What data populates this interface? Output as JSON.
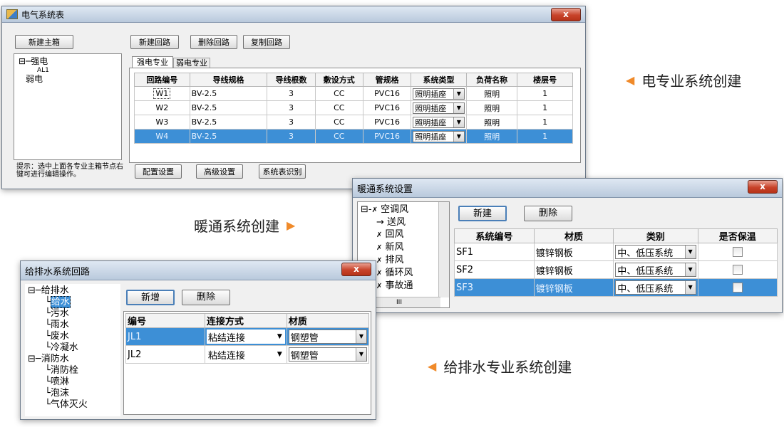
{
  "win1": {
    "title": "电气系统表",
    "close": "x",
    "new_main_box": "新建主箱",
    "new_circuit": "新建回路",
    "delete_circuit": "删除回路",
    "copy_circuit": "复制回路",
    "tree": [
      "强电",
      "AL1",
      "弱电"
    ],
    "hint": "提示：选中上面各专业主箱节点右键可进行编辑操作。",
    "tabs": [
      "强电专业",
      "弱电专业"
    ],
    "columns": [
      "回路编号",
      "导线规格",
      "导线根数",
      "敷设方式",
      "管规格",
      "系统类型",
      "负荷名称",
      "楼层号"
    ],
    "rows": [
      [
        "W1",
        "BV-2.5",
        "3",
        "CC",
        "PVC16",
        "照明插座",
        "照明",
        "1"
      ],
      [
        "W2",
        "BV-2.5",
        "3",
        "CC",
        "PVC16",
        "照明插座",
        "照明",
        "1"
      ],
      [
        "W3",
        "BV-2.5",
        "3",
        "CC",
        "PVC16",
        "照明插座",
        "照明",
        "1"
      ],
      [
        "W4",
        "BV-2.5",
        "3",
        "CC",
        "PVC16",
        "照明插座",
        "照明",
        "1"
      ]
    ],
    "config_settings": "配置设置",
    "advanced_settings": "高级设置",
    "system_table_recognition": "系统表识别"
  },
  "win2": {
    "title": "暖通系统设置",
    "close": "x",
    "tree": [
      "空调风",
      "送风",
      "回风",
      "新风",
      "排风",
      "循环风",
      "事故通"
    ],
    "scroll_label": "III",
    "new": "新建",
    "delete": "删除",
    "columns": [
      "系统编号",
      "材质",
      "类别",
      "是否保温"
    ],
    "rows": [
      [
        "SF1",
        "镀锌钢板",
        "中、低压系统"
      ],
      [
        "SF2",
        "镀锌钢板",
        "中、低压系统"
      ],
      [
        "SF3",
        "镀锌钢板",
        "中、低压系统"
      ]
    ]
  },
  "win3": {
    "title": "给排水系统回路",
    "close": "x",
    "tree": [
      "给排水",
      "给水",
      "污水",
      "雨水",
      "废水",
      "冷凝水",
      "消防水",
      "消防栓",
      "喷淋",
      "泡沫",
      "气体灭火"
    ],
    "add": "新增",
    "delete": "删除",
    "columns": [
      "编号",
      "连接方式",
      "材质"
    ],
    "rows": [
      [
        "JL1",
        "粘结连接",
        "钢塑管"
      ],
      [
        "JL2",
        "粘结连接",
        "钢塑管"
      ]
    ]
  },
  "captions": {
    "electrical": "电专业系统创建",
    "hvac": "暖通系统创建",
    "plumbing": "给排水专业系统创建"
  },
  "colors": {
    "selection": "#3d8fd6",
    "accent_arrow": "#f08a2a"
  }
}
